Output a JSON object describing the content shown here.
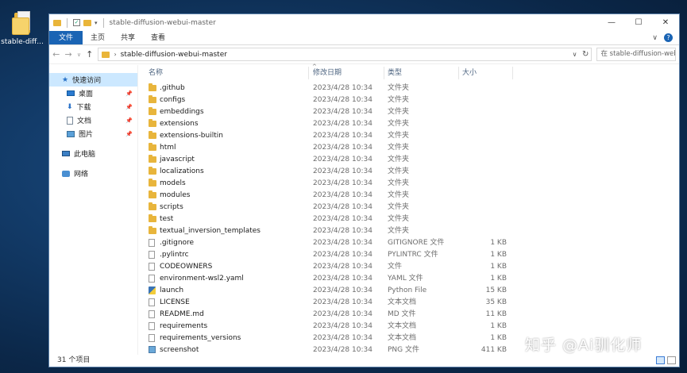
{
  "desktop": {
    "icon_label": "stable-diff..."
  },
  "window": {
    "title": "stable-diffusion-webui-master",
    "controls": {
      "minimize": "—",
      "maximize": "☐",
      "close": "✕"
    }
  },
  "ribbon": {
    "tabs": [
      "文件",
      "主页",
      "共享",
      "查看"
    ],
    "expand_glyph": "∨",
    "help_glyph": "?"
  },
  "address": {
    "path": "stable-diffusion-webui-master",
    "search_placeholder": "在 stable-diffusion-webui-m..."
  },
  "sidebar": {
    "quick_access": "快速访问",
    "items": [
      {
        "label": "桌面",
        "icon": "desktop-icon",
        "pinned": true
      },
      {
        "label": "下载",
        "icon": "download-icon",
        "pinned": true
      },
      {
        "label": "文档",
        "icon": "document-icon",
        "pinned": true
      },
      {
        "label": "图片",
        "icon": "picture-icon",
        "pinned": true
      }
    ],
    "this_pc": "此电脑",
    "network": "网络"
  },
  "columns": {
    "name": "名称",
    "date": "修改日期",
    "type": "类型",
    "size": "大小"
  },
  "files": [
    {
      "name": ".github",
      "date": "2023/4/28 10:34",
      "type": "文件夹",
      "size": "",
      "kind": "folder"
    },
    {
      "name": "configs",
      "date": "2023/4/28 10:34",
      "type": "文件夹",
      "size": "",
      "kind": "folder"
    },
    {
      "name": "embeddings",
      "date": "2023/4/28 10:34",
      "type": "文件夹",
      "size": "",
      "kind": "folder"
    },
    {
      "name": "extensions",
      "date": "2023/4/28 10:34",
      "type": "文件夹",
      "size": "",
      "kind": "folder"
    },
    {
      "name": "extensions-builtin",
      "date": "2023/4/28 10:34",
      "type": "文件夹",
      "size": "",
      "kind": "folder"
    },
    {
      "name": "html",
      "date": "2023/4/28 10:34",
      "type": "文件夹",
      "size": "",
      "kind": "folder"
    },
    {
      "name": "javascript",
      "date": "2023/4/28 10:34",
      "type": "文件夹",
      "size": "",
      "kind": "folder"
    },
    {
      "name": "localizations",
      "date": "2023/4/28 10:34",
      "type": "文件夹",
      "size": "",
      "kind": "folder"
    },
    {
      "name": "models",
      "date": "2023/4/28 10:34",
      "type": "文件夹",
      "size": "",
      "kind": "folder"
    },
    {
      "name": "modules",
      "date": "2023/4/28 10:34",
      "type": "文件夹",
      "size": "",
      "kind": "folder"
    },
    {
      "name": "scripts",
      "date": "2023/4/28 10:34",
      "type": "文件夹",
      "size": "",
      "kind": "folder"
    },
    {
      "name": "test",
      "date": "2023/4/28 10:34",
      "type": "文件夹",
      "size": "",
      "kind": "folder"
    },
    {
      "name": "textual_inversion_templates",
      "date": "2023/4/28 10:34",
      "type": "文件夹",
      "size": "",
      "kind": "folder"
    },
    {
      "name": ".gitignore",
      "date": "2023/4/28 10:34",
      "type": "GITIGNORE 文件",
      "size": "1 KB",
      "kind": "file"
    },
    {
      "name": ".pylintrc",
      "date": "2023/4/28 10:34",
      "type": "PYLINTRC 文件",
      "size": "1 KB",
      "kind": "file"
    },
    {
      "name": "CODEOWNERS",
      "date": "2023/4/28 10:34",
      "type": "文件",
      "size": "1 KB",
      "kind": "file"
    },
    {
      "name": "environment-wsl2.yaml",
      "date": "2023/4/28 10:34",
      "type": "YAML 文件",
      "size": "1 KB",
      "kind": "file"
    },
    {
      "name": "launch",
      "date": "2023/4/28 10:34",
      "type": "Python File",
      "size": "15 KB",
      "kind": "python"
    },
    {
      "name": "LICENSE",
      "date": "2023/4/28 10:34",
      "type": "文本文档",
      "size": "35 KB",
      "kind": "file"
    },
    {
      "name": "README.md",
      "date": "2023/4/28 10:34",
      "type": "MD 文件",
      "size": "11 KB",
      "kind": "file"
    },
    {
      "name": "requirements",
      "date": "2023/4/28 10:34",
      "type": "文本文档",
      "size": "1 KB",
      "kind": "file"
    },
    {
      "name": "requirements_versions",
      "date": "2023/4/28 10:34",
      "type": "文本文档",
      "size": "1 KB",
      "kind": "file"
    },
    {
      "name": "screenshot",
      "date": "2023/4/28 10:34",
      "type": "PNG 文件",
      "size": "411 KB",
      "kind": "image"
    }
  ],
  "status": {
    "item_count": "31 个项目"
  },
  "watermark": "知乎 @Ai驯化师"
}
